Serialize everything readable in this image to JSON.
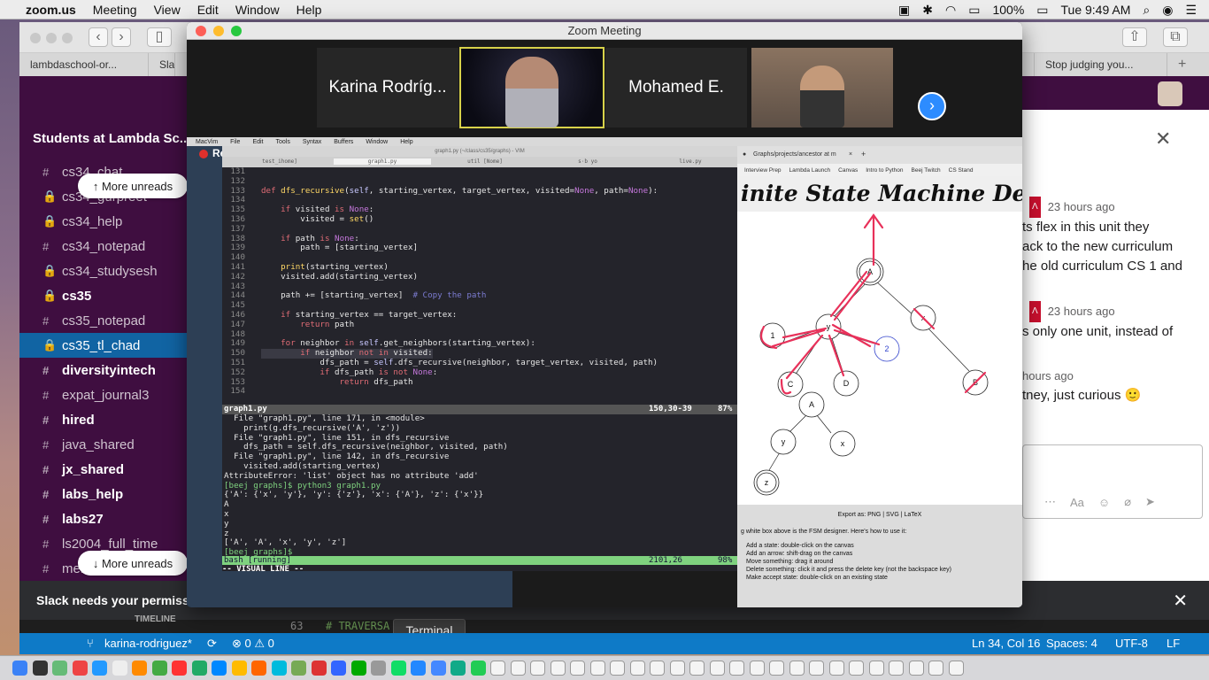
{
  "menubar": {
    "app": "zoom.us",
    "items": [
      "Meeting",
      "View",
      "Edit",
      "Window",
      "Help"
    ],
    "battery": "100%",
    "time": "Tue 9:49 AM"
  },
  "browser": {
    "tabs": [
      "lambdaschool-or...",
      "Slac",
      "",
      "",
      "",
      "",
      "",
      "",
      "",
      "",
      "Stop judging you..."
    ],
    "new_tab": "+"
  },
  "slack": {
    "workspace": "Students at Lambda Sc...",
    "more_unreads_top": "More unreads",
    "more_unreads_bottom": "More unreads",
    "channels": [
      {
        "sym": "#",
        "name": "cs34_chat",
        "bold": false
      },
      {
        "sym": "🔒",
        "name": "cs34_gurpreet",
        "bold": false
      },
      {
        "sym": "🔒",
        "name": "cs34_help",
        "bold": false
      },
      {
        "sym": "#",
        "name": "cs34_notepad",
        "bold": false
      },
      {
        "sym": "🔒",
        "name": "cs34_studysesh",
        "bold": false
      },
      {
        "sym": "🔒",
        "name": "cs35",
        "bold": true
      },
      {
        "sym": "#",
        "name": "cs35_notepad",
        "bold": false
      },
      {
        "sym": "🔒",
        "name": "cs35_tl_chad",
        "bold": false,
        "selected": true
      },
      {
        "sym": "#",
        "name": "diversityintech",
        "bold": true
      },
      {
        "sym": "#",
        "name": "expat_journal3",
        "bold": false
      },
      {
        "sym": "#",
        "name": "hired",
        "bold": true
      },
      {
        "sym": "#",
        "name": "java_shared",
        "bold": false
      },
      {
        "sym": "#",
        "name": "jx_shared",
        "bold": true
      },
      {
        "sym": "#",
        "name": "labs_help",
        "bold": true
      },
      {
        "sym": "#",
        "name": "labs27",
        "bold": true
      },
      {
        "sym": "#",
        "name": "ls2004_full_time",
        "bold": false
      },
      {
        "sym": "#",
        "name": "mentorbuddy",
        "bold": false
      }
    ],
    "notice": "Slack needs your permissi",
    "thread": {
      "m1_time": "23 hours ago",
      "m1_l1": "ts flex in this unit they",
      "m1_l2": "ack to the new curriculum",
      "m1_l3": "he old curriculum CS 1 and",
      "m2_time": "23 hours ago",
      "m2_l1": "s only one unit, instead of",
      "m3_time": "hours ago",
      "m3_l1": "tney, just curious",
      "composer_hint": "Aa"
    }
  },
  "zoom": {
    "title": "Zoom Meeting",
    "participants": [
      "Karina Rodríg...",
      "Mohamed E."
    ],
    "recording": "Recording"
  },
  "vim": {
    "menus": [
      "MacVim",
      "File",
      "Edit",
      "Tools",
      "Syntax",
      "Buffers",
      "Window",
      "Help"
    ],
    "tabs": [
      "test_ihome]",
      "graph1.py",
      "util [Nome]",
      "s·b yo",
      "live.py"
    ],
    "title": "graph1.py (~/class/cs35/graphs) - VIM",
    "status1_file": "graph1.py",
    "status1_pos": "150,30-39",
    "status1_pct": "87%",
    "status2_name": "bash [running]",
    "status2_pos": "2101,26",
    "status2_pct": "98%",
    "mode": "-- VISUAL LINE --",
    "term": [
      "  File \"graph1.py\", line 171, in <module>",
      "    print(g.dfs_recursive('A', 'z'))",
      "  File \"graph1.py\", line 151, in dfs_recursive",
      "    dfs_path = self.dfs_recursive(neighbor, visited, path)",
      "  File \"graph1.py\", line 142, in dfs_recursive",
      "    visited.add(starting_vertex)",
      "AttributeError: 'list' object has no attribute 'add'",
      "[beej graphs]$ python3 graph1.py",
      "{'A': {'x', 'y'}, 'y': {'z'}, 'x': {'A'}, 'z': {'x'}}",
      "A",
      "x",
      "y",
      "z",
      "['A', 'A', 'x', 'y', 'z']",
      "[beej graphs]$"
    ]
  },
  "fsm": {
    "tab": "Graphs/projects/ancestor at m",
    "bookmarks": [
      "Interview Prep",
      "Lambda Launch",
      "Canvas",
      "Intro to Python",
      "Beej Twitch",
      "CS Stand"
    ],
    "title": "inite State Machine Desig",
    "nodes": [
      "A",
      "y",
      "x",
      "1",
      "C",
      "D",
      "B",
      "2",
      "A",
      "y",
      "x",
      "z"
    ],
    "export": "Export as: PNG | SVG | LaTeX",
    "intro": "g white box above is the FSM designer.  Here's how to use it:",
    "howto": [
      "Add a state: double-click on the canvas",
      "Add an arrow: shift-drag on the canvas",
      "Move something: drag it around",
      "Delete something: click it and press the delete key (not the backspace key)",
      "Make accept state: double-click on an existing state"
    ]
  },
  "vscode": {
    "line_no": "63",
    "code": "# TRAVERSA",
    "timeline": "TIMELINE",
    "tooltip": "Terminal"
  },
  "statusbar": {
    "branch": "karina-rodriguez*",
    "problems": "⊗ 0  ⚠ 0",
    "cursor": "Ln 34, Col 16",
    "spaces": "Spaces: 4",
    "encoding": "UTF-8",
    "eol": "LF"
  },
  "colors": {
    "slack_purple": "#3f0e40",
    "slack_selected": "#1164a3",
    "vscode_blue": "#0e7ac7",
    "recording_red": "#e0302c",
    "annotation_red": "#e8315a"
  }
}
